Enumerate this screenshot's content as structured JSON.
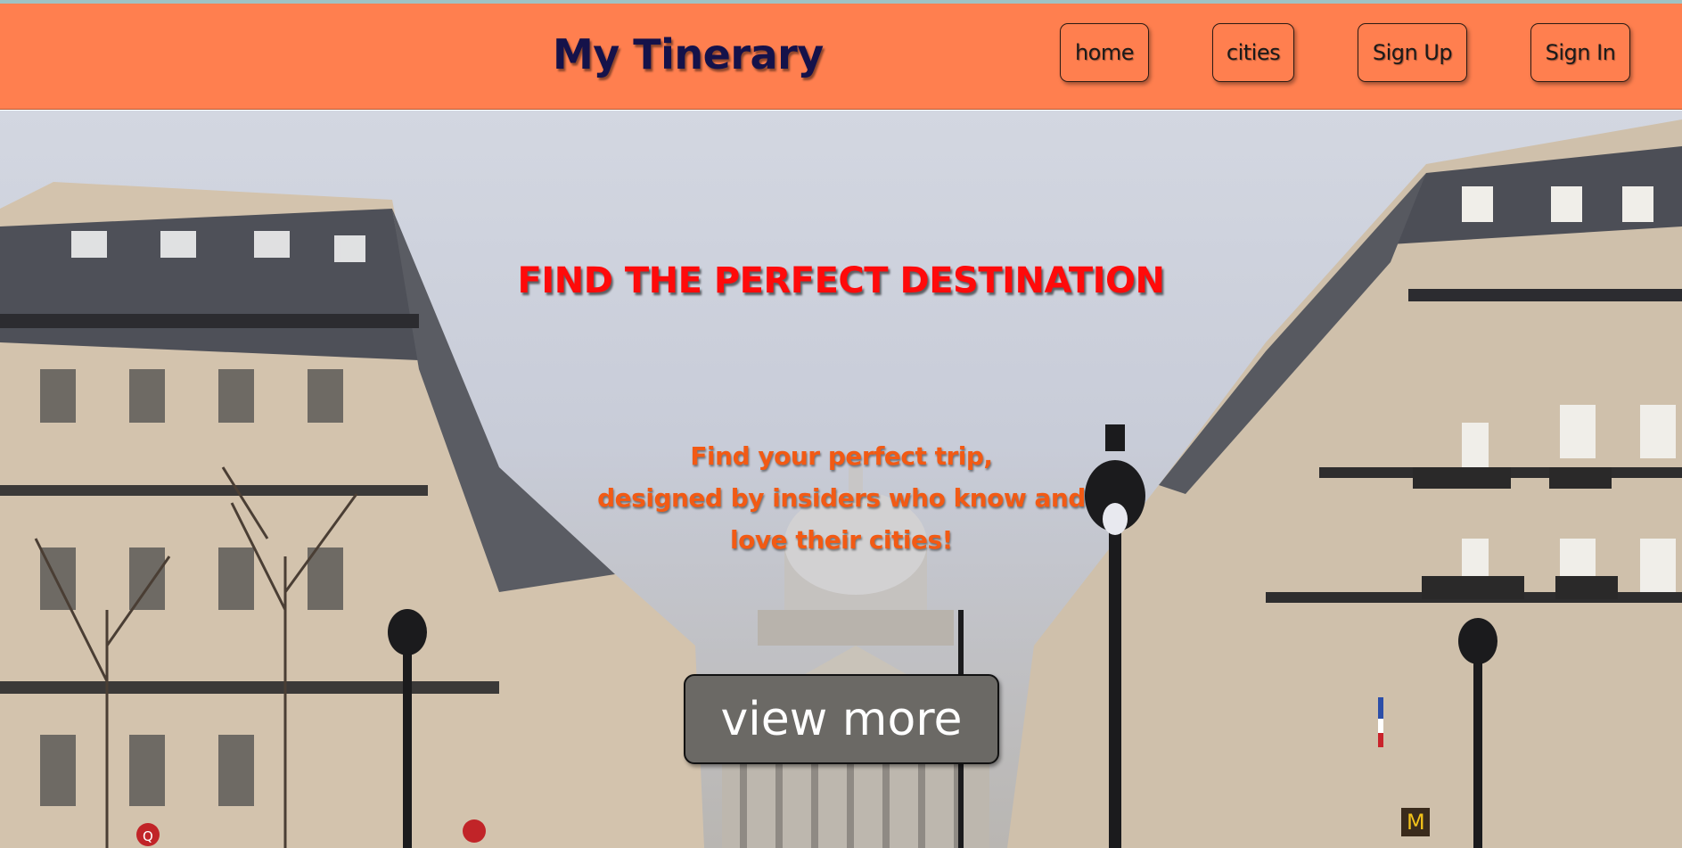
{
  "header": {
    "brand": "My Tinerary",
    "nav": [
      {
        "label": "home"
      },
      {
        "label": "cities"
      },
      {
        "label": "Sign Up"
      },
      {
        "label": "Sign In"
      }
    ]
  },
  "hero": {
    "headline": "FIND THE PERFECT DESTINATION",
    "subline": [
      "Find your perfect trip,",
      "designed by insiders who know and",
      "love their cities!"
    ],
    "cta_label": "view more",
    "background_image": "paris-street-pantheon-snow",
    "sign_text": "Q"
  },
  "colors": {
    "header_bg": "#ff7f4f",
    "brand_text": "#15124a",
    "headline_text": "#ff0a0a",
    "subline_text": "#f25a14",
    "cta_bg": "#6b6965"
  }
}
